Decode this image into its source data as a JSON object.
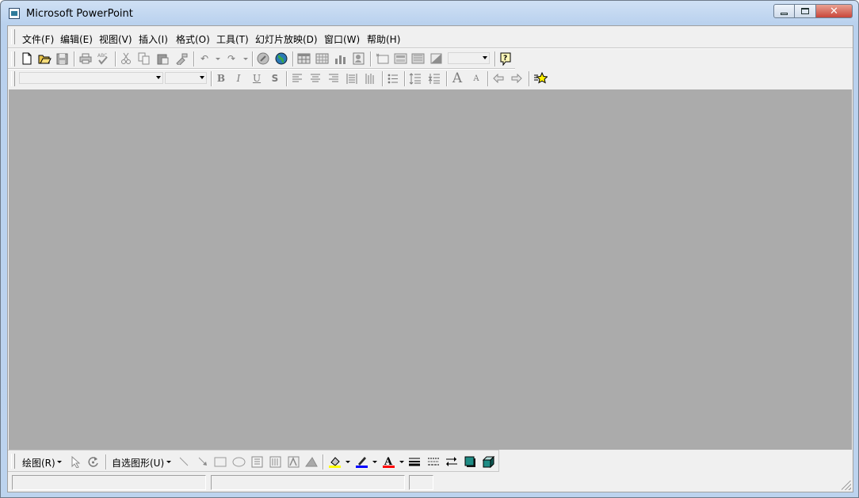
{
  "window": {
    "title": "Microsoft PowerPoint",
    "icon": "powerpoint-app-icon"
  },
  "caption_buttons": {
    "minimize": "▭",
    "maximize": "□",
    "close": "✕"
  },
  "menu": [
    {
      "label": "文件(F)"
    },
    {
      "label": "编辑(E)"
    },
    {
      "label": "视图(V)"
    },
    {
      "label": "插入(I)"
    },
    {
      "label": "格式(O)"
    },
    {
      "label": "工具(T)"
    },
    {
      "label": "幻灯片放映(D)"
    },
    {
      "label": "窗口(W)"
    },
    {
      "label": "帮助(H)"
    }
  ],
  "standard_toolbar": {
    "icons": [
      "new-document-icon",
      "open-folder-icon",
      "save-icon",
      "print-icon",
      "spelling-icon",
      "cut-icon",
      "copy-icon",
      "paste-icon",
      "format-painter-icon",
      "undo-icon",
      "redo-icon",
      "insert-hyperlink-icon",
      "web-toolbar-icon",
      "insert-word-table-icon",
      "insert-excel-worksheet-icon",
      "insert-chart-icon",
      "insert-clip-art-icon",
      "new-slide-icon",
      "slide-layout-icon",
      "apply-design-icon",
      "grayscale-preview-icon",
      "zoom-combo",
      "office-assistant-icon"
    ],
    "zoom_value": ""
  },
  "formatting_toolbar": {
    "font_name": "",
    "font_size": "",
    "bold": "B",
    "italic": "I",
    "underline": "U",
    "shadow": "S",
    "increase_font": "A",
    "decrease_font": "A"
  },
  "drawing_toolbar": {
    "draw_menu": "绘图(R)",
    "autoshapes_menu": "自选图形(U)"
  },
  "colors": {
    "workspace": "#ababab",
    "fill_color": "#ffff00",
    "line_color": "#0000ff",
    "font_color": "#ff0000"
  },
  "statusbar": {
    "panel1": "",
    "panel2": "",
    "panel3": ""
  }
}
